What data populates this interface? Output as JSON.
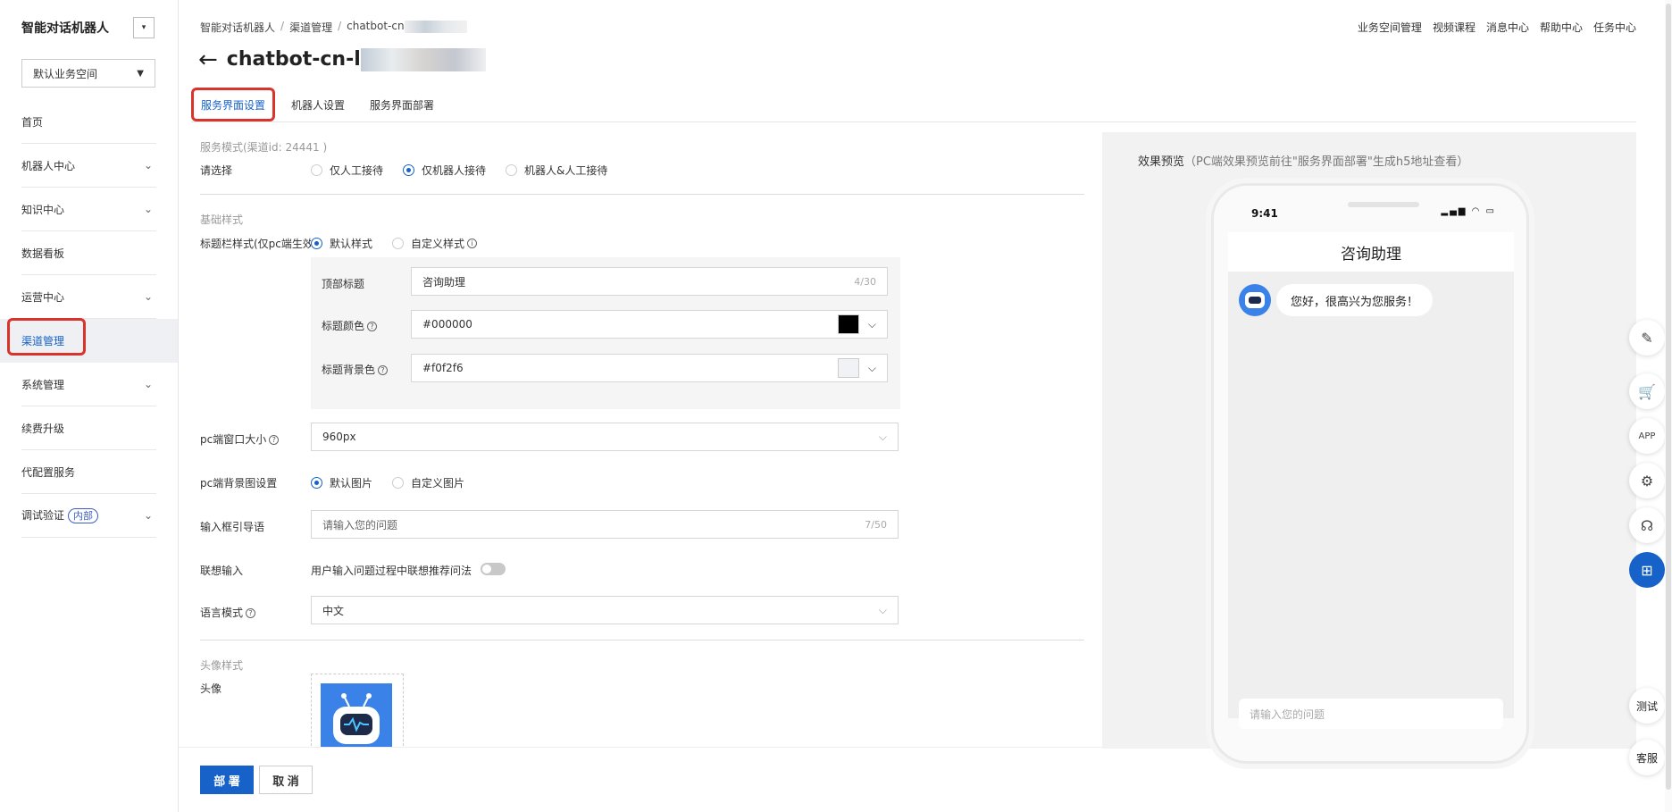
{
  "sidebar": {
    "title": "智能对话机器人",
    "toggle_icon": "▾",
    "workspace": "默认业务空间",
    "items": [
      {
        "label": "首页",
        "chevron": ""
      },
      {
        "label": "机器人中心",
        "chevron": "⌄"
      },
      {
        "label": "知识中心",
        "chevron": "⌄"
      },
      {
        "label": "数据看板",
        "chevron": ""
      },
      {
        "label": "运营中心",
        "chevron": "⌄"
      },
      {
        "label": "渠道管理",
        "chevron": ""
      },
      {
        "label": "系统管理",
        "chevron": "⌄"
      },
      {
        "label": "续费升级",
        "chevron": ""
      },
      {
        "label": "代配置服务",
        "chevron": ""
      },
      {
        "label": "调试验证",
        "badge": "内部",
        "chevron": "⌄"
      }
    ]
  },
  "breadcrumb": [
    "智能对话机器人",
    "/",
    "渠道管理",
    "/",
    "chatbot-cn"
  ],
  "top_links": [
    "业务空间管理",
    "视频课程",
    "消息中心",
    "帮助中心",
    "任务中心"
  ],
  "page_title": "chatbot-cn-l",
  "tabs": [
    "服务界面设置",
    "机器人设置",
    "服务界面部署"
  ],
  "form": {
    "service_mode_title": "服务模式(渠道id: 24441 )",
    "choose_label": "请选择",
    "service_options": [
      "仅人工接待",
      "仅机器人接待",
      "机器人&人工接待"
    ],
    "basic_style_title": "基础样式",
    "titlebar_label": "标题栏样式(仅pc端生效",
    "titlebar_options": [
      "默认样式",
      "自定义样式"
    ],
    "top_title_label": "顶部标题",
    "top_title_value": "咨询助理",
    "top_title_count": "4/30",
    "title_color_label": "标题颜色",
    "title_color_value": "#000000",
    "title_bg_label": "标题背景色",
    "title_bg_value": "#f0f2f6",
    "pc_size_label": "pc端窗口大小",
    "pc_size_value": "960px",
    "pc_bg_label": "pc端背景图设置",
    "pc_bg_options": [
      "默认图片",
      "自定义图片"
    ],
    "input_guide_label": "输入框引导语",
    "input_guide_value": "请输入您的问题",
    "input_guide_count": "7/50",
    "assoc_label": "联想输入",
    "assoc_desc": "用户输入问题过程中联想推荐问法",
    "lang_label": "语言模式",
    "lang_value": "中文",
    "avatar_section_title": "头像样式",
    "avatar_label": "头像"
  },
  "footer": {
    "deploy": "部 署",
    "cancel": "取 消"
  },
  "preview": {
    "title": "效果预览",
    "hint": "（PC端效果预览前往\"服务界面部署\"生成h5地址查看）",
    "time": "9:41",
    "status_icons": "▂▄▆ ◠ ▭",
    "chat_title": "咨询助理",
    "greeting": "您好，很高兴为您服务！",
    "input_placeholder": "请输入您的问题"
  },
  "float": {
    "edit": "✎",
    "cart": "🛒",
    "app": "APP",
    "settings": "⚙",
    "support": "☊",
    "apps": "⊞",
    "test": "测试",
    "service": "客服"
  },
  "colors": {
    "accent": "#1662c8",
    "highlight": "#d9342b",
    "title_color": "#000000",
    "title_bg": "#f0f2f6"
  }
}
